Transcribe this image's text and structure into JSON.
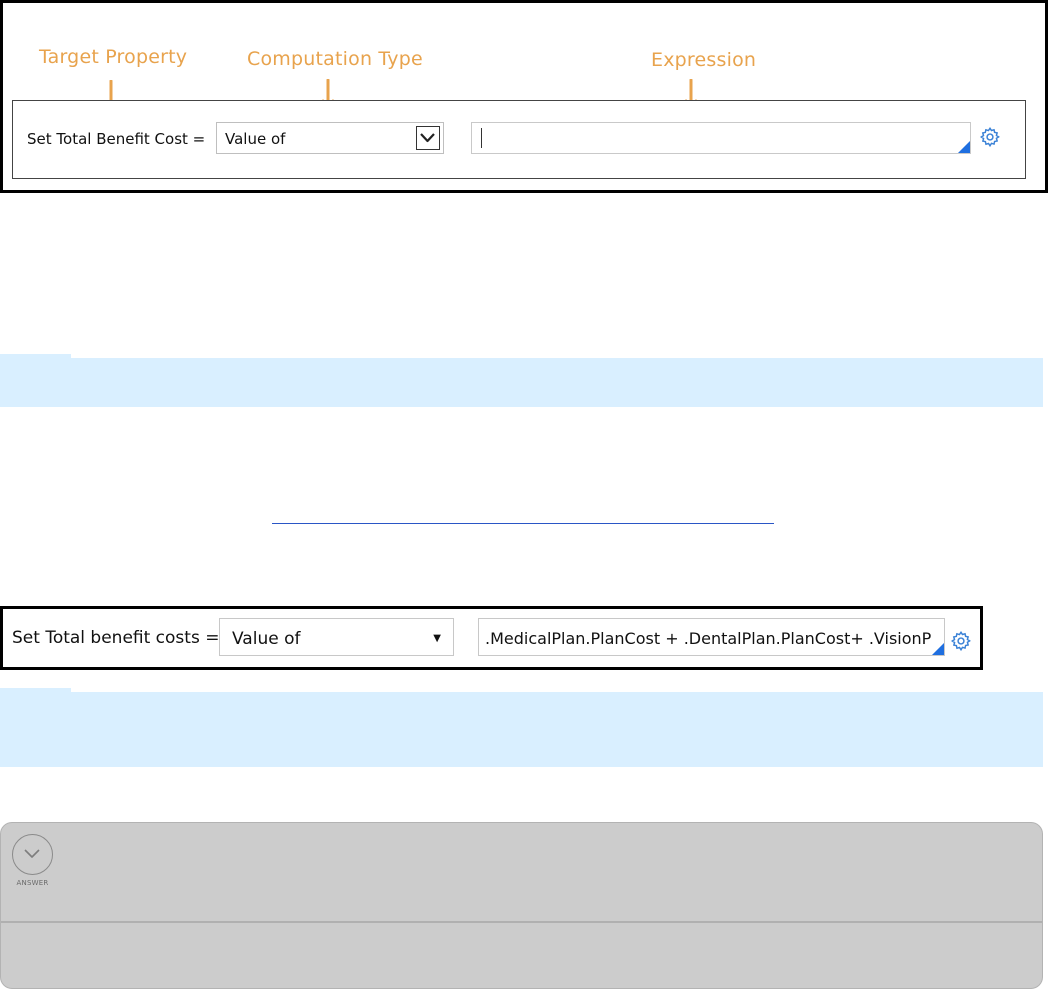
{
  "figure1": {
    "annotations": {
      "target_property": "Target Property",
      "computation_type": "Computation Type",
      "expression": "Expression"
    },
    "rule_label": "Set Total Benefit Cost =",
    "computation_select_value": "Value of",
    "expression_value": "",
    "annotation_color": "#e8a34d"
  },
  "figure2": {
    "rule_label": "Set Total benefit costs =",
    "computation_select_value": "Value of",
    "expression_value": ".MedicalPlan.PlanCost + .DentalPlan.PlanCost+ .VisionP"
  },
  "answer": {
    "toggle_label": "ANSWER"
  },
  "colors": {
    "note_background": "#d9efff",
    "link": "#2a56c6",
    "answer_panel": "#cccccc",
    "expression_corner": "#1f6fe0",
    "gear": "#3b82d6"
  },
  "icons": [
    "chevron-down-icon",
    "gear-icon",
    "dropdown-triangle-icon",
    "expand-circle-icon"
  ]
}
